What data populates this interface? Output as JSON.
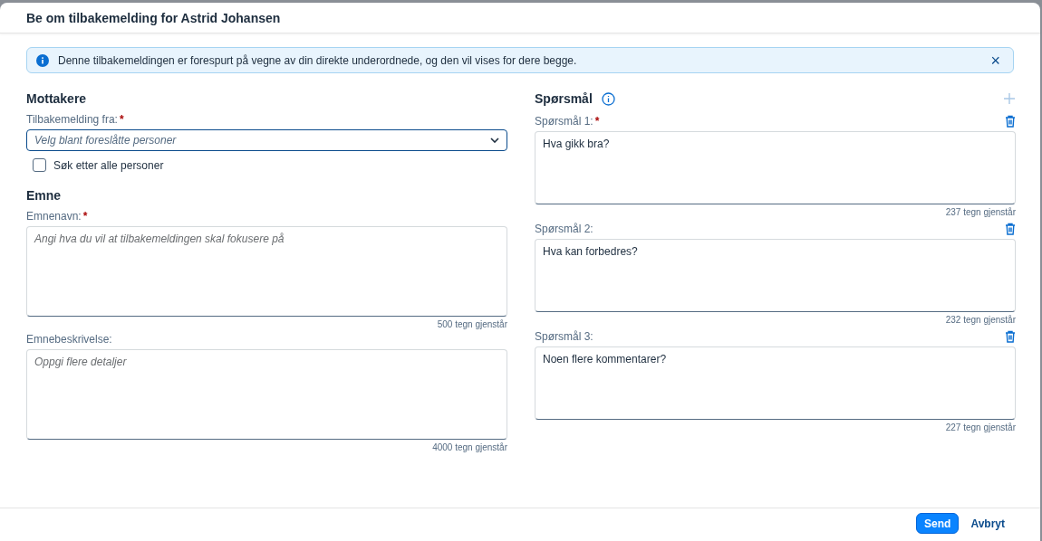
{
  "dialog": {
    "title": "Be om tilbakemelding for Astrid Johansen"
  },
  "info_banner": {
    "text": "Denne tilbakemeldingen er forespurt på vegne av din direkte underordnede, og den vil vises for dere begge.",
    "close": "×"
  },
  "recipients": {
    "heading": "Mottakere",
    "field_label": "Tilbakemelding fra:",
    "required_mark": "*",
    "placeholder": "Velg blant foreslåtte personer",
    "checkbox": {
      "label": "Søk etter alle personer",
      "checked": false
    }
  },
  "subject": {
    "heading": "Emne",
    "fields": [
      {
        "label": "Emnenavn:",
        "required_mark": "*",
        "placeholder": "Angi hva du vil at tilbakemeldingen skal fokusere på",
        "counter": "500 tegn gjenstår"
      },
      {
        "label": "Emnebeskrivelse:",
        "placeholder": "Oppgi flere detaljer",
        "counter": "4000 tegn gjenstår"
      }
    ]
  },
  "questions": {
    "heading": "Spørsmål",
    "add_disabled": true,
    "items": [
      {
        "label": "Spørsmål 1:",
        "required_mark": "*",
        "value": "Hva gikk bra?",
        "counter": "237 tegn gjenstår"
      },
      {
        "label": "Spørsmål 2:",
        "value": "Hva kan forbedres?",
        "counter": "232 tegn gjenstår"
      },
      {
        "label": "Spørsmål 3:",
        "value": "Noen flere kommentarer?",
        "counter": "227 tegn gjenstår"
      }
    ]
  },
  "footer": {
    "buttons": [
      {
        "label": "Send",
        "kind": "primary"
      },
      {
        "label": "Avbryt",
        "kind": "transparent"
      }
    ]
  }
}
